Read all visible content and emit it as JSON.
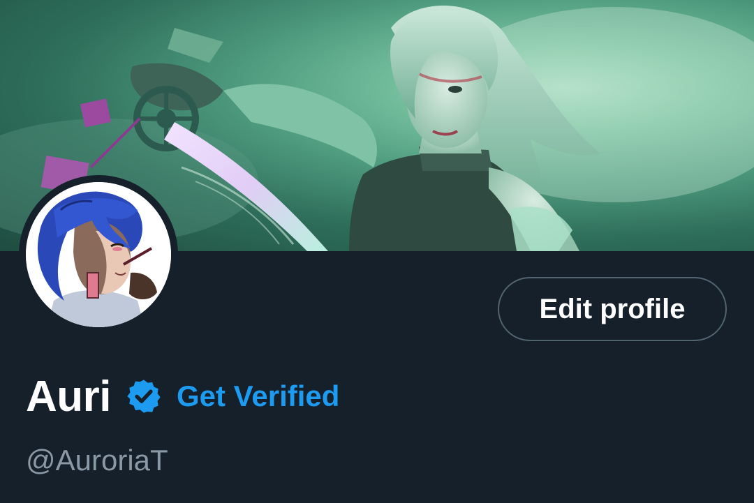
{
  "profile": {
    "display_name": "Auri",
    "handle": "@AuroriaT",
    "get_verified_label": "Get Verified",
    "edit_profile_label": "Edit profile"
  },
  "icons": {
    "verified": "verified-badge-icon"
  },
  "colors": {
    "background": "#15202b",
    "accent": "#1d9bf0",
    "secondary_text": "#8b98a5",
    "button_border": "#536471"
  }
}
